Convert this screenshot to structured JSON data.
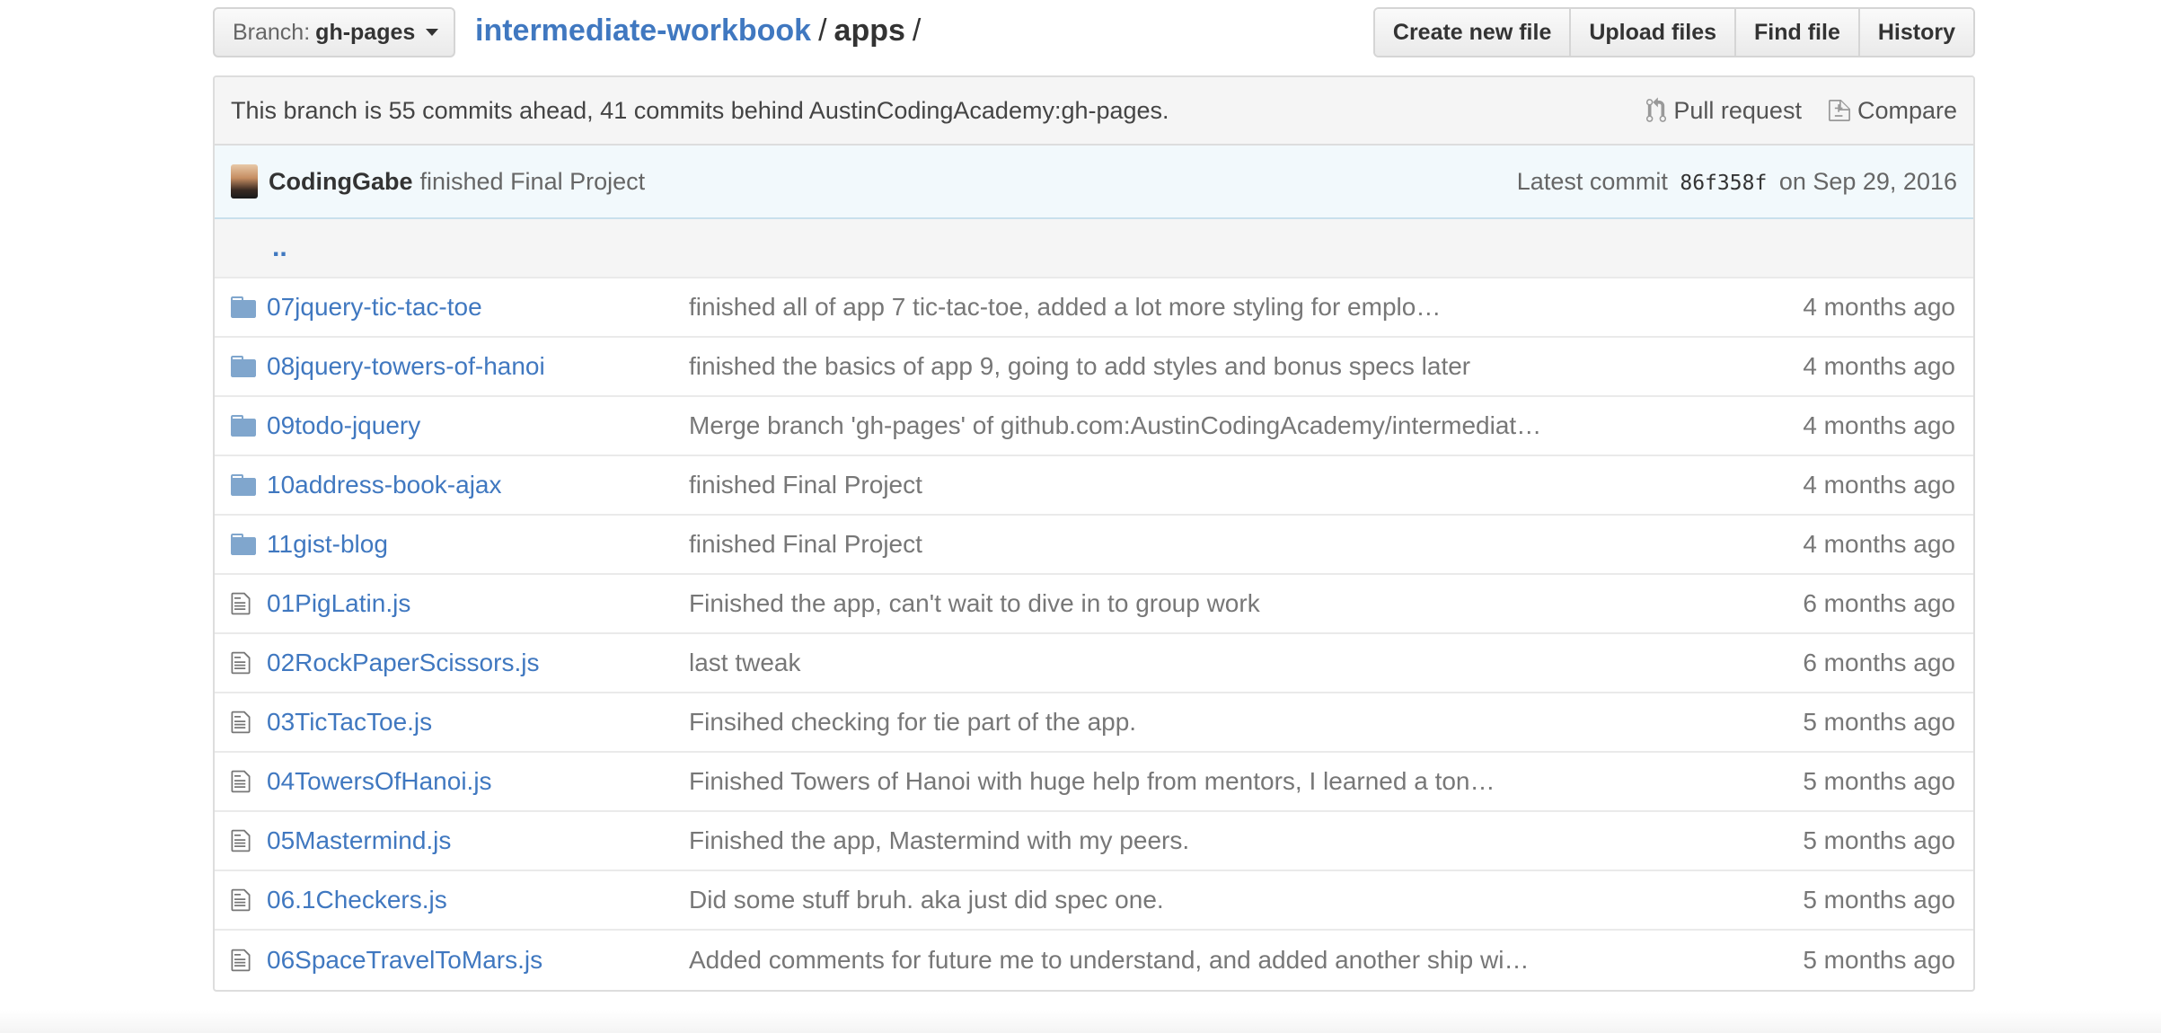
{
  "branch": {
    "prefix": "Branch:",
    "name": "gh-pages"
  },
  "breadcrumb": {
    "repo": "intermediate-workbook",
    "sep1": "/",
    "folder": "apps",
    "sep2": "/"
  },
  "actions": {
    "create": "Create new file",
    "upload": "Upload files",
    "find": "Find file",
    "history": "History"
  },
  "branch_info": {
    "message": "This branch is 55 commits ahead, 41 commits behind AustinCodingAcademy:gh-pages.",
    "pull_request": "Pull request",
    "compare": "Compare"
  },
  "latest_commit": {
    "author": "CodingGabe",
    "message": "finished Final Project",
    "label": "Latest commit",
    "sha": "86f358f",
    "date": "on Sep 29, 2016"
  },
  "parent_dir": "..",
  "colors": {
    "link": "#4078c0",
    "folder": "#80a6cd",
    "file": "#777777"
  },
  "files": [
    {
      "type": "dir",
      "icon": "folder-icon",
      "name": "07jquery-tic-tac-toe",
      "message": "finished all of app 7 tic-tac-toe, added a lot more styling for emplo…",
      "age": "4 months ago"
    },
    {
      "type": "dir",
      "icon": "folder-icon",
      "name": "08jquery-towers-of-hanoi",
      "message": "finished the basics of app 9, going to add styles and bonus specs later",
      "age": "4 months ago"
    },
    {
      "type": "dir",
      "icon": "folder-icon",
      "name": "09todo-jquery",
      "message": "Merge branch 'gh-pages' of github.com:AustinCodingAcademy/intermediat…",
      "age": "4 months ago"
    },
    {
      "type": "dir",
      "icon": "folder-icon",
      "name": "10address-book-ajax",
      "message": "finished Final Project",
      "age": "4 months ago"
    },
    {
      "type": "dir",
      "icon": "folder-icon",
      "name": "11gist-blog",
      "message": "finished Final Project",
      "age": "4 months ago"
    },
    {
      "type": "file",
      "icon": "file-icon",
      "name": "01PigLatin.js",
      "message": "Finished the app, can't wait to dive in to group work",
      "age": "6 months ago"
    },
    {
      "type": "file",
      "icon": "file-icon",
      "name": "02RockPaperScissors.js",
      "message": "last tweak",
      "age": "6 months ago"
    },
    {
      "type": "file",
      "icon": "file-icon",
      "name": "03TicTacToe.js",
      "message": "Finsihed checking for tie part of the app.",
      "age": "5 months ago"
    },
    {
      "type": "file",
      "icon": "file-icon",
      "name": "04TowersOfHanoi.js",
      "message": "Finished Towers of Hanoi with huge help from mentors, I learned a ton…",
      "age": "5 months ago"
    },
    {
      "type": "file",
      "icon": "file-icon",
      "name": "05Mastermind.js",
      "message": "Finished the app, Mastermind with my peers.",
      "age": "5 months ago"
    },
    {
      "type": "file",
      "icon": "file-icon",
      "name": "06.1Checkers.js",
      "message": "Did some stuff bruh. aka just did spec one.",
      "age": "5 months ago"
    },
    {
      "type": "file",
      "icon": "file-icon",
      "name": "06SpaceTravelToMars.js",
      "message": "Added comments for future me to understand, and added another ship wi…",
      "age": "5 months ago"
    }
  ]
}
